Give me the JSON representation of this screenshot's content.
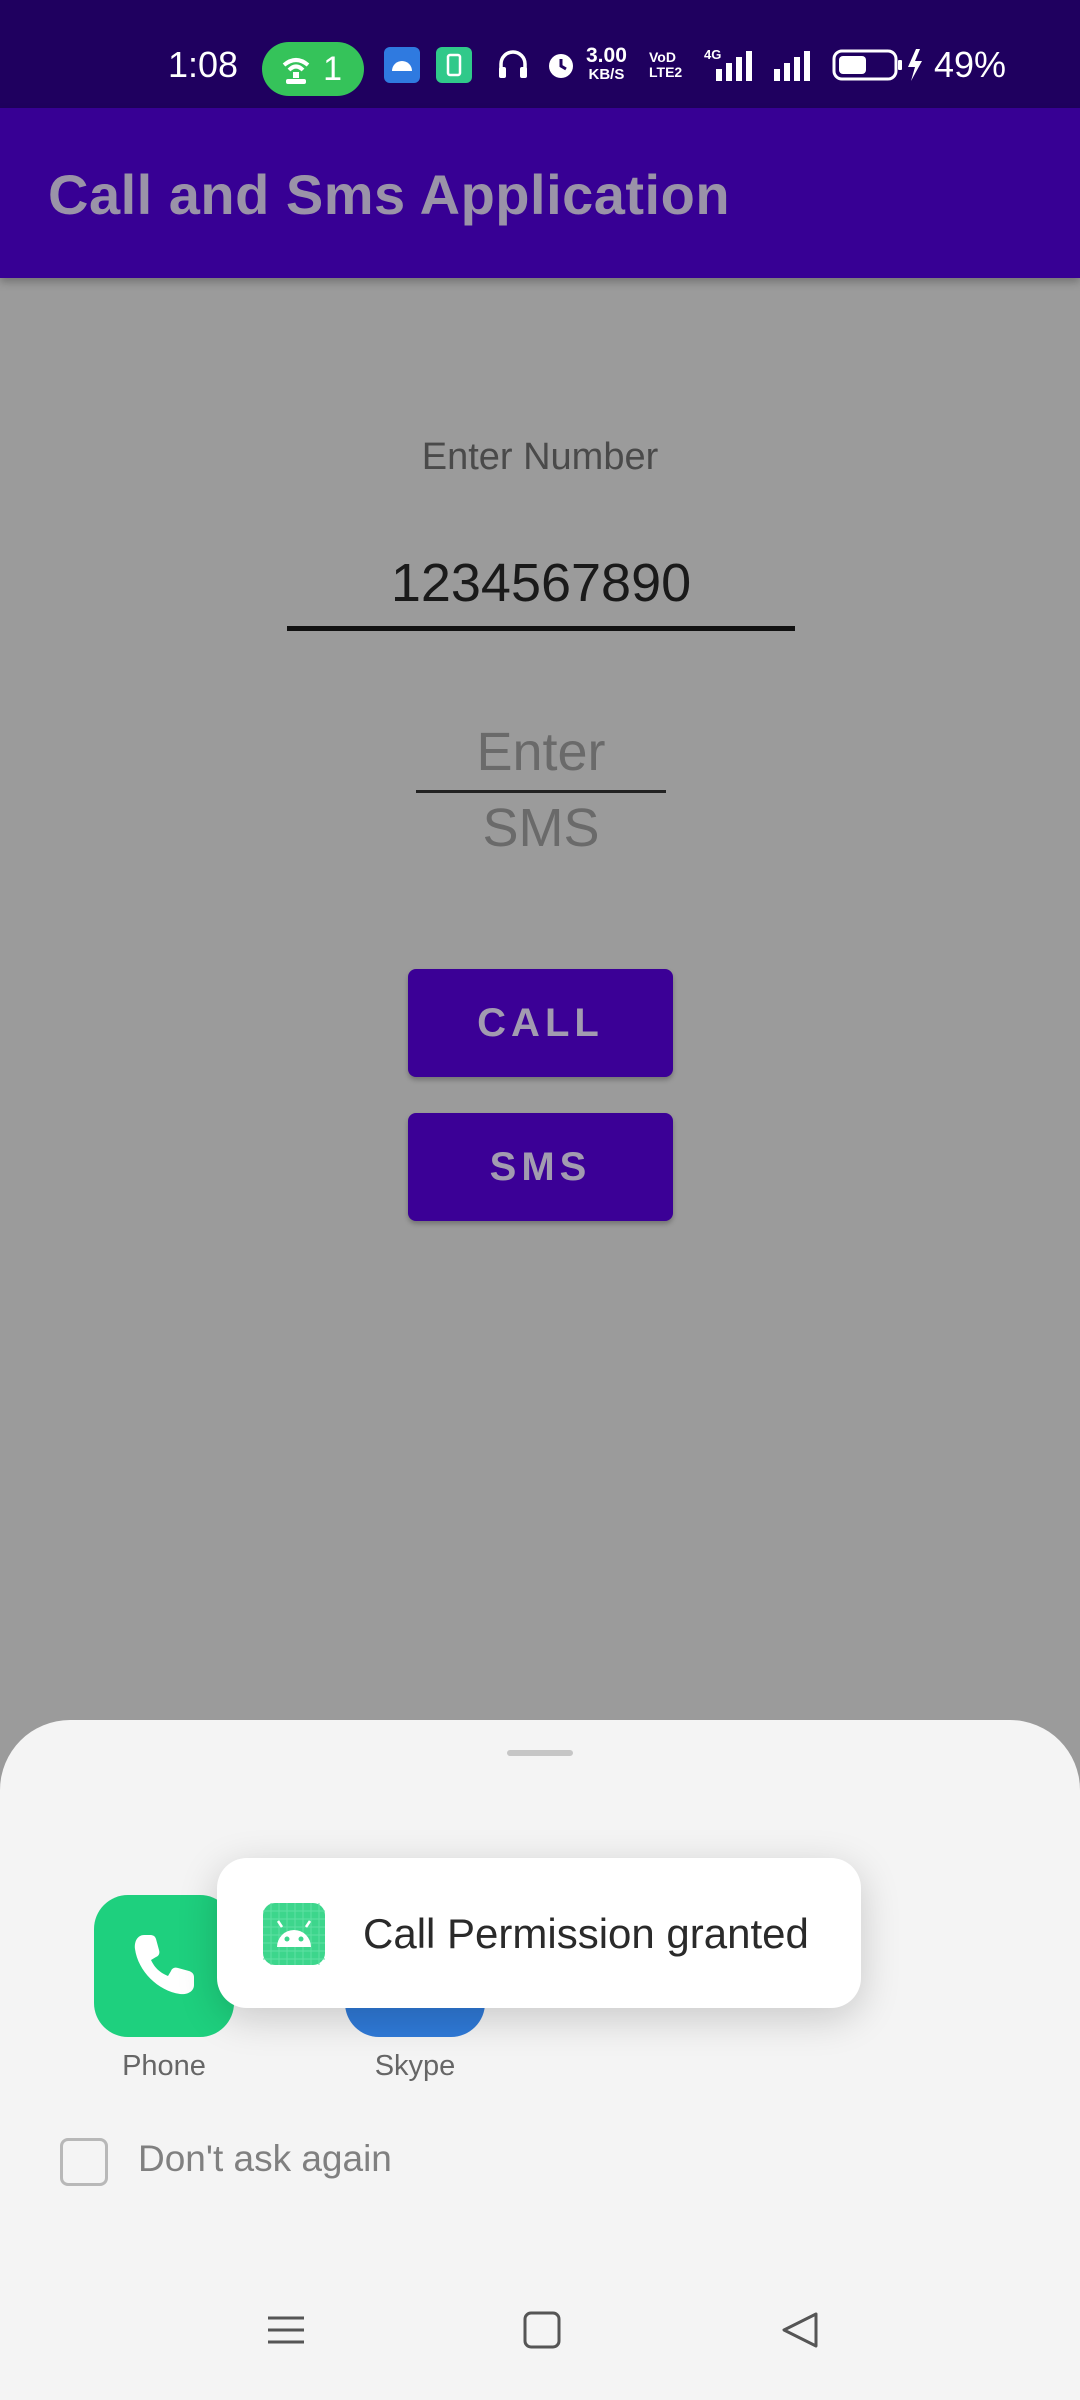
{
  "status_bar": {
    "time": "1:08",
    "hotspot_count": "1",
    "net_speed_value": "3.00",
    "net_speed_unit": "KB/S",
    "volte_top": "VoD",
    "volte_bottom": "LTE2",
    "battery": "49%"
  },
  "app_bar": {
    "title": "Call and Sms Application"
  },
  "form": {
    "number_label": "Enter Number",
    "number_value": "1234567890",
    "sms_placeholder": "Enter SMS",
    "call_button": "CALL",
    "sms_button": "SMS"
  },
  "chooser": {
    "apps": [
      {
        "label": "Phone",
        "icon": "phone-icon"
      },
      {
        "label": "Skype",
        "icon": "skype-icon"
      }
    ],
    "dont_ask_again": "Don't ask again"
  },
  "toast": {
    "message": "Call Permission granted",
    "icon": "android-icon"
  },
  "nav_bar": {
    "icons": [
      "menu-icon",
      "home-icon",
      "back-icon"
    ]
  },
  "colors": {
    "status_bar": "#1f005f",
    "app_bar": "#370094",
    "button": "#3b0096",
    "scrim": "#9b9b9b",
    "phone_green": "#1ed07e",
    "skype_blue": "#2f7ad8"
  }
}
